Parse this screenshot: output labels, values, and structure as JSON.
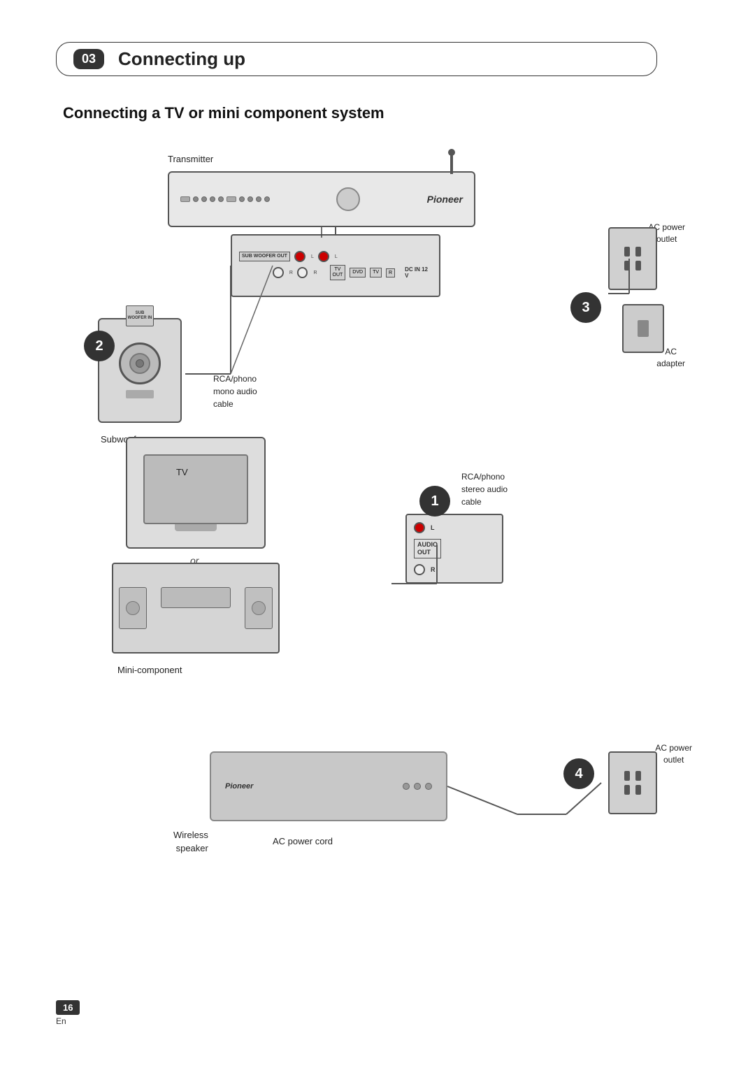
{
  "page": {
    "number": "16",
    "language": "En",
    "background_color": "#ffffff"
  },
  "section": {
    "number": "03",
    "title": "Connecting up"
  },
  "subtitle": "Connecting a TV or mini component system",
  "labels": {
    "transmitter": "Transmitter",
    "subwoofer": "Subwoofer",
    "rca_mono": "RCA/phono\nmono audio\ncable",
    "rca_stereo": "RCA/phono\nstereo audio\ncable",
    "ac_power_outlet_top": "AC power\noutlet",
    "ac_adapter": "AC\nadapter",
    "tv": "TV",
    "or": "or",
    "mini_component": "Mini-component",
    "wireless_speaker": "Wireless\nspeaker",
    "ac_power_cord": "AC  power cord",
    "ac_power_outlet_bottom": "AC power\noutlet",
    "audio_out": "AUDIO\nOUT",
    "woofer_out": "SUB\nWOOFER\nOUT",
    "woofer_in": "SUB\nWOOFER\nIN",
    "dc_in": "DC IN 12 V",
    "step1": "1",
    "step2": "2",
    "step3": "3",
    "step4": "4",
    "pioneer_logo": "Pioneer",
    "L": "L",
    "R": "R"
  }
}
